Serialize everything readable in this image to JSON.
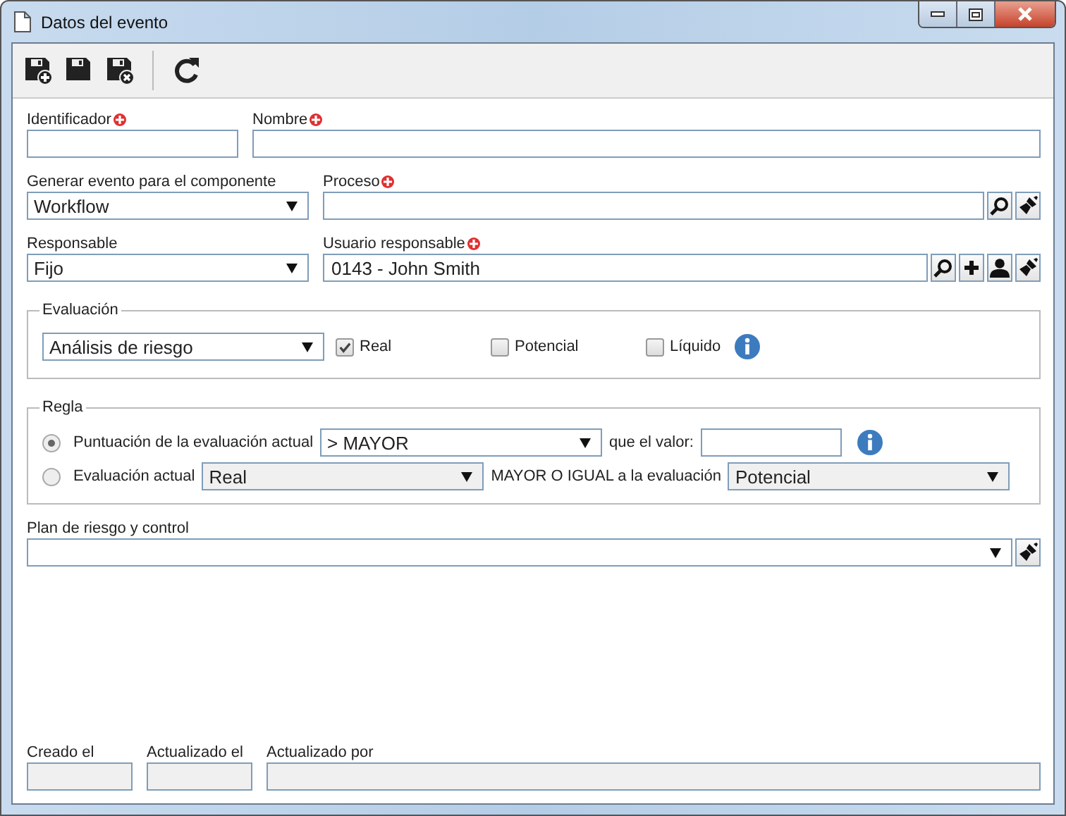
{
  "window": {
    "title": "Datos del evento"
  },
  "toolbar": [
    {
      "kind": "save-new"
    },
    {
      "kind": "save"
    },
    {
      "kind": "save-close"
    },
    {
      "kind": "refresh"
    }
  ],
  "identificador": {
    "label": "Identificador",
    "required": true
  },
  "nombre": {
    "label": "Nombre",
    "required": true
  },
  "componente": {
    "label": "Generar evento para el componente",
    "value": "Workflow"
  },
  "proceso": {
    "label": "Proceso",
    "required": true,
    "buttons": [
      {
        "kind": "search"
      },
      {
        "kind": "clear"
      }
    ]
  },
  "responsable": {
    "label": "Responsable",
    "value": "Fijo"
  },
  "usuario": {
    "label": "Usuario responsable",
    "required": true,
    "value": "0143 - John Smith",
    "buttons": [
      {
        "kind": "search"
      },
      {
        "kind": "add"
      },
      {
        "kind": "user"
      },
      {
        "kind": "clear"
      }
    ]
  },
  "evaluacion": {
    "legend": "Evaluación",
    "select": "Análisis de riesgo",
    "options": [
      {
        "label": "Real",
        "checked": true,
        "info": false
      },
      {
        "label": "Potencial",
        "checked": false,
        "info": false
      },
      {
        "label": "Líquido",
        "checked": false,
        "info": true
      }
    ]
  },
  "regla": {
    "legend": "Regla",
    "rules": [
      {
        "kind": "score",
        "label": "Puntuación de la evaluación actual",
        "selected": true,
        "operator": "> MAYOR",
        "value_label": "que el valor:"
      },
      {
        "kind": "compare",
        "label": "Evaluación actual",
        "selected": false,
        "current": "Real",
        "relation": "MAYOR O IGUAL a la evaluación",
        "target": "Potencial"
      }
    ]
  },
  "plan": {
    "label": "Plan de riesgo y control",
    "buttons": [
      {
        "kind": "clear"
      }
    ]
  },
  "footer": [
    {
      "label": "Creado el",
      "disabled": true
    },
    {
      "label": "Actualizado el",
      "disabled": true
    },
    {
      "label": "Actualizado por",
      "disabled": true
    }
  ]
}
